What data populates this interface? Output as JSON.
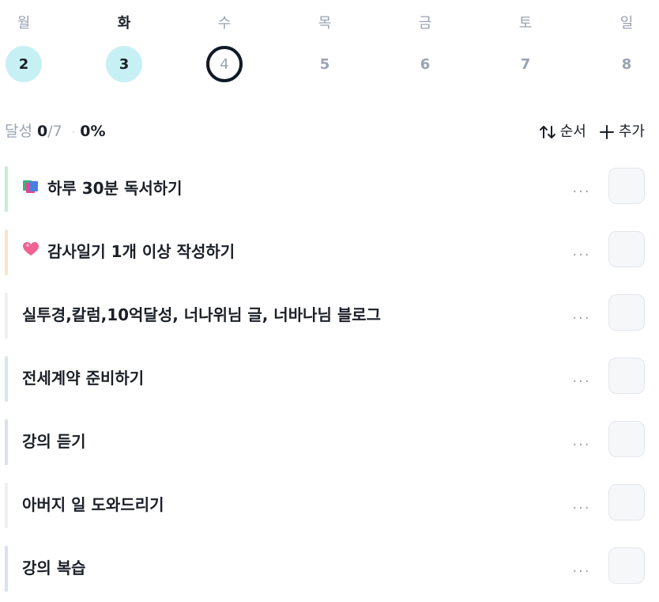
{
  "week": {
    "days": [
      {
        "name": "월",
        "date": "2",
        "state": "done"
      },
      {
        "name": "화",
        "date": "3",
        "state": "done"
      },
      {
        "name": "수",
        "date": "4",
        "state": "selected"
      },
      {
        "name": "목",
        "date": "5",
        "state": "none"
      },
      {
        "name": "금",
        "date": "6",
        "state": "none"
      },
      {
        "name": "토",
        "date": "7",
        "state": "none"
      },
      {
        "name": "일",
        "date": "8",
        "state": "none"
      }
    ],
    "today_name": "화"
  },
  "summary": {
    "label": "달성",
    "completed": "0",
    "total": "/7",
    "separator": "·",
    "percent": "0%"
  },
  "toolbar": {
    "sort_label": "순서",
    "add_label": "추가"
  },
  "habits": [
    {
      "emoji": "books",
      "title": "하루 30분 독서하기",
      "bar_color": "#c7ecd9",
      "checked": false
    },
    {
      "emoji": "heart",
      "title": "감사일기 1개 이상 작성하기",
      "bar_color": "#fde3c3",
      "checked": false
    },
    {
      "emoji": "",
      "title": "실투경,칼럼,10억달성, 너나위님 글, 너바나님 블로그",
      "bar_color": "#eeeff1",
      "checked": false
    },
    {
      "emoji": "",
      "title": "전세계약 준비하기",
      "bar_color": "#d7e6ea",
      "checked": false
    },
    {
      "emoji": "",
      "title": "강의 듣기",
      "bar_color": "#d8e0f4",
      "checked": false
    },
    {
      "emoji": "",
      "title": "아버지 일 도와드리기",
      "bar_color": "#eeeff1",
      "checked": false
    },
    {
      "emoji": "",
      "title": "강의 복습",
      "bar_color": "#d8e0f4",
      "checked": false
    }
  ],
  "more_label": "···",
  "colors": {
    "done_circle": "#c7f0f4",
    "selected_ring": "#111827",
    "muted_text": "#9aa3b2",
    "primary_text": "#1b1f27"
  }
}
